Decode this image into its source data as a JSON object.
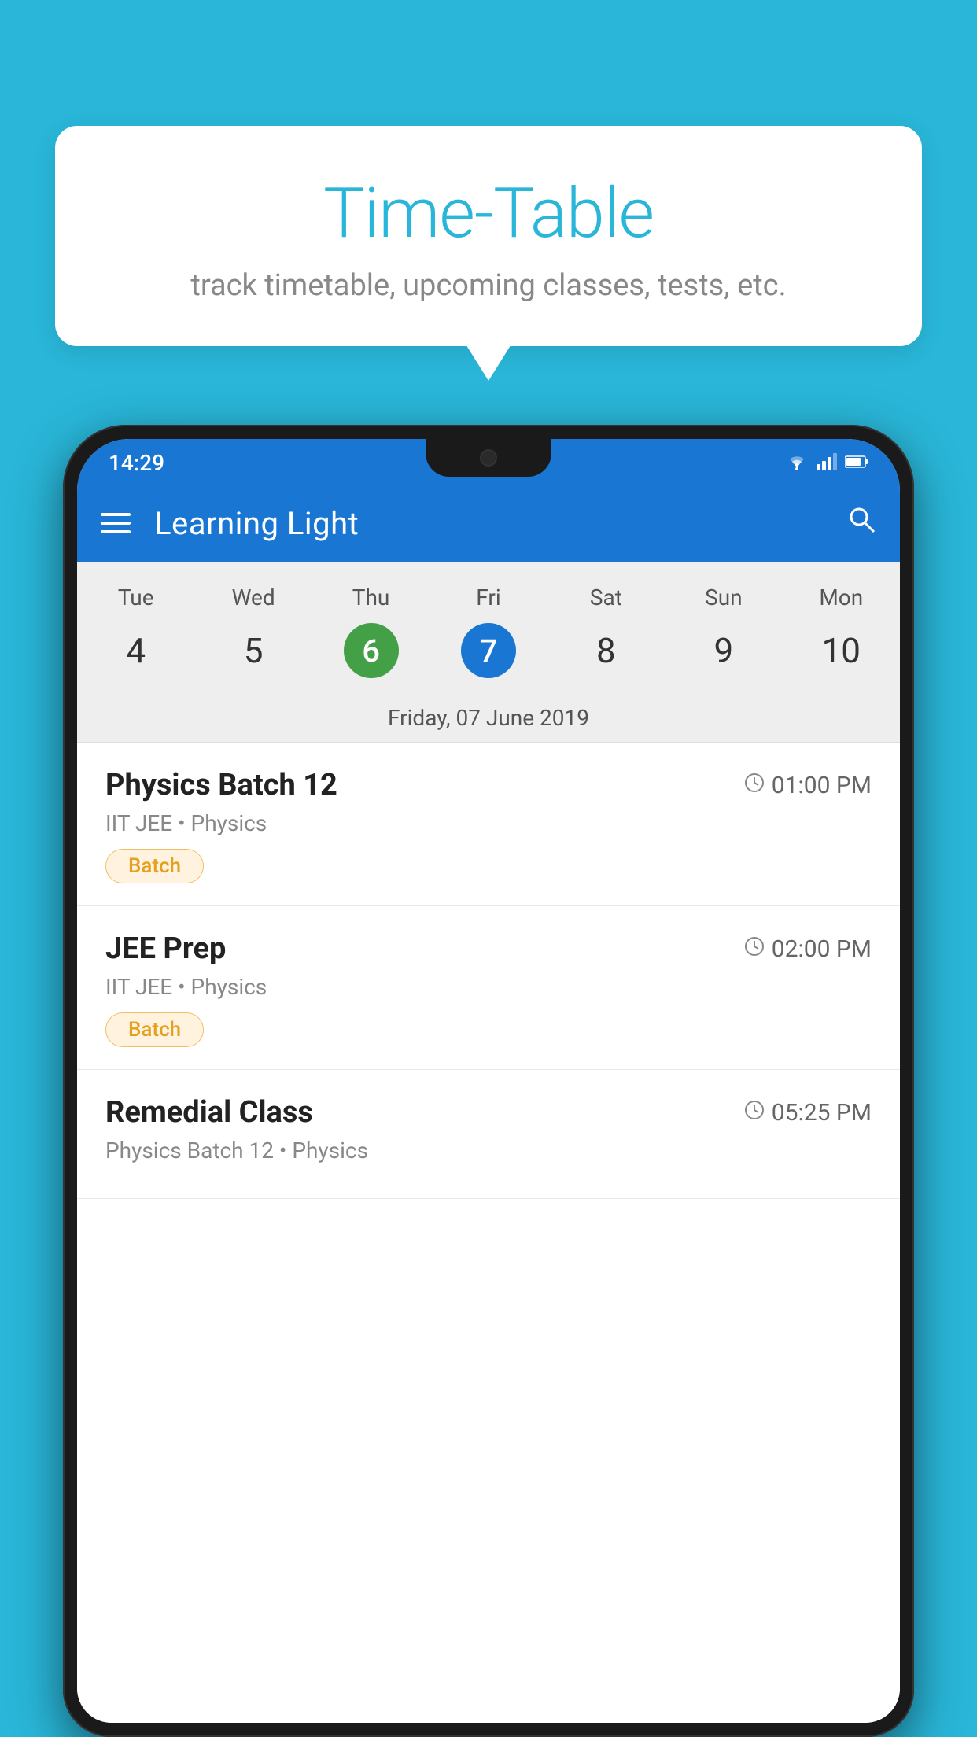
{
  "background_color": "#29b6d8",
  "bubble": {
    "title": "Time-Table",
    "subtitle": "track timetable, upcoming classes, tests, etc."
  },
  "status_bar": {
    "time": "14:29"
  },
  "app_bar": {
    "title": "Learning Light",
    "menu_icon": "hamburger-icon",
    "search_icon": "search-icon"
  },
  "calendar": {
    "days": [
      {
        "name": "Tue",
        "number": "4",
        "state": "normal"
      },
      {
        "name": "Wed",
        "number": "5",
        "state": "normal"
      },
      {
        "name": "Thu",
        "number": "6",
        "state": "today"
      },
      {
        "name": "Fri",
        "number": "7",
        "state": "selected"
      },
      {
        "name": "Sat",
        "number": "8",
        "state": "normal"
      },
      {
        "name": "Sun",
        "number": "9",
        "state": "normal"
      },
      {
        "name": "Mon",
        "number": "10",
        "state": "normal"
      }
    ],
    "selected_date_label": "Friday, 07 June 2019"
  },
  "schedule": {
    "items": [
      {
        "title": "Physics Batch 12",
        "time": "01:00 PM",
        "subtitle": "IIT JEE • Physics",
        "badge": "Batch"
      },
      {
        "title": "JEE Prep",
        "time": "02:00 PM",
        "subtitle": "IIT JEE • Physics",
        "badge": "Batch"
      },
      {
        "title": "Remedial Class",
        "time": "05:25 PM",
        "subtitle": "Physics Batch 12 • Physics",
        "badge": null
      }
    ]
  }
}
